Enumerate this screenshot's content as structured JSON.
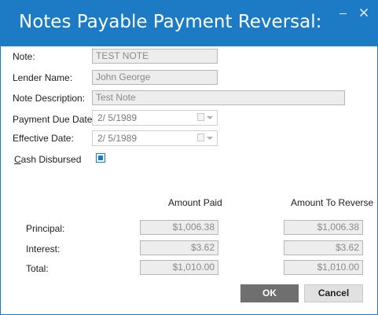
{
  "window": {
    "title": "Notes Payable Payment Reversal:",
    "accent_color": "#1c7bc4"
  },
  "form": {
    "note_label": "Note:",
    "note_value": "TEST NOTE",
    "lender_label": "Lender Name:",
    "lender_value": "John George",
    "description_label": "Note Description:",
    "description_value": "Test Note",
    "payment_due_label": "Payment Due Date:",
    "payment_due_value": "2/  5/1989",
    "effective_label": "Effective Date:",
    "effective_value": "2/  5/1989",
    "cash_disbursed_label_prefix": "C",
    "cash_disbursed_label_rest": "ash Disbursed",
    "cash_disbursed_checked": true
  },
  "amounts": {
    "col_paid": "Amount Paid",
    "col_reverse": "Amount To Reverse",
    "rows": [
      {
        "label": "Principal:",
        "paid": "$1,006.38",
        "reverse": "$1,006.38"
      },
      {
        "label": "Interest:",
        "paid": "$3.62",
        "reverse": "$3.62"
      },
      {
        "label": "Total:",
        "paid": "$1,010.00",
        "reverse": "$1,010.00"
      }
    ]
  },
  "buttons": {
    "ok": "OK",
    "cancel": "Cancel"
  },
  "icons": {
    "minimize": "minimize-icon",
    "close": "close-icon",
    "calendar": "calendar-icon",
    "dropdown": "chevron-down-icon"
  }
}
